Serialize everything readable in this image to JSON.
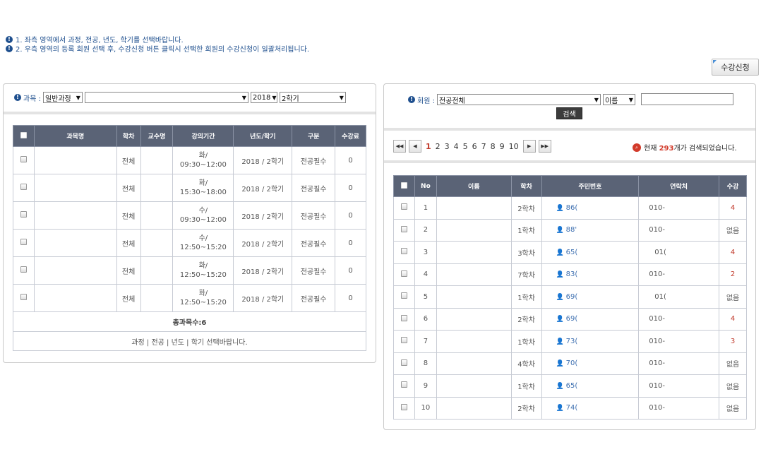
{
  "notices": [
    "1. 좌측 영역에서 과정, 전공, 년도, 학기를 선택바랍니다.",
    "2. 우측 영역의 등록 회원 선택 후, 수강신청 버튼 클릭시 선택한 회원의 수강신청이 일괄처리됩니다."
  ],
  "enroll_button": "수강신청",
  "left": {
    "filter_label": "과목 :",
    "course_select": "일반과정",
    "subject_select": "",
    "year_select": "2018",
    "term_select": "2학기",
    "columns": [
      "과목명",
      "학차",
      "교수명",
      "강의기간",
      "년도/학기",
      "구분",
      "수강료"
    ],
    "rows": [
      {
        "name": "",
        "grade": "전체",
        "prof": "",
        "period1": "화/",
        "period2": "09:30~12:00",
        "yt": "2018 / 2학기",
        "type": "전공필수",
        "fee": "0"
      },
      {
        "name": "",
        "grade": "전체",
        "prof": "",
        "period1": "화/",
        "period2": "15:30~18:00",
        "yt": "2018 / 2학기",
        "type": "전공필수",
        "fee": "0"
      },
      {
        "name": "",
        "grade": "전체",
        "prof": "",
        "period1": "수/",
        "period2": "09:30~12:00",
        "yt": "2018 / 2학기",
        "type": "전공필수",
        "fee": "0"
      },
      {
        "name": "",
        "grade": "전체",
        "prof": "",
        "period1": "수/",
        "period2": "12:50~15:20",
        "yt": "2018 / 2학기",
        "type": "전공필수",
        "fee": "0"
      },
      {
        "name": "",
        "grade": "전체",
        "prof": "",
        "period1": "화/",
        "period2": "12:50~15:20",
        "yt": "2018 / 2학기",
        "type": "전공필수",
        "fee": "0"
      },
      {
        "name": "",
        "grade": "전체",
        "prof": "",
        "period1": "화/",
        "period2": "12:50~15:20",
        "yt": "2018 / 2학기",
        "type": "전공필수",
        "fee": "0"
      }
    ],
    "total": "총과목수:6",
    "footer": "과정 | 전공 | 년도 | 학기 선택바랍니다."
  },
  "right": {
    "filter_label": "회원 :",
    "major_select": "전공전체",
    "field_select": "이름",
    "search_value": "",
    "search_button": "검색",
    "pages": [
      "1",
      "2",
      "3",
      "4",
      "5",
      "6",
      "7",
      "8",
      "9",
      "10"
    ],
    "result_prefix": "현재 ",
    "result_count": "293",
    "result_suffix": "개가 검색되었습니다.",
    "columns": [
      "No",
      "이름",
      "학차",
      "주민번호",
      "연락처",
      "수강"
    ],
    "rows": [
      {
        "no": "1",
        "name": "",
        "grade": "2학차",
        "id": "86(",
        "phone": "010-",
        "count": "4"
      },
      {
        "no": "2",
        "name": "",
        "grade": "1학차",
        "id": "88'",
        "phone": "010-",
        "count": "없음"
      },
      {
        "no": "3",
        "name": "",
        "grade": "3학차",
        "id": "65(",
        "phone": "01(",
        "count": "4"
      },
      {
        "no": "4",
        "name": "",
        "grade": "7학차",
        "id": "83(",
        "phone": "010-",
        "count": "2"
      },
      {
        "no": "5",
        "name": "",
        "grade": "1학차",
        "id": "69(",
        "phone": "01(",
        "count": "없음"
      },
      {
        "no": "6",
        "name": "",
        "grade": "2학차",
        "id": "69(",
        "phone": "010-",
        "count": "4"
      },
      {
        "no": "7",
        "name": "",
        "grade": "1학차",
        "id": "73(",
        "phone": "010-",
        "count": "3"
      },
      {
        "no": "8",
        "name": "",
        "grade": "4학차",
        "id": "70(",
        "phone": "010-",
        "count": "없음"
      },
      {
        "no": "9",
        "name": "",
        "grade": "1학차",
        "id": "65(",
        "phone": "010-",
        "count": "없음"
      },
      {
        "no": "10",
        "name": "",
        "grade": "2학차",
        "id": "74(",
        "phone": "010-",
        "count": "없음"
      }
    ]
  }
}
